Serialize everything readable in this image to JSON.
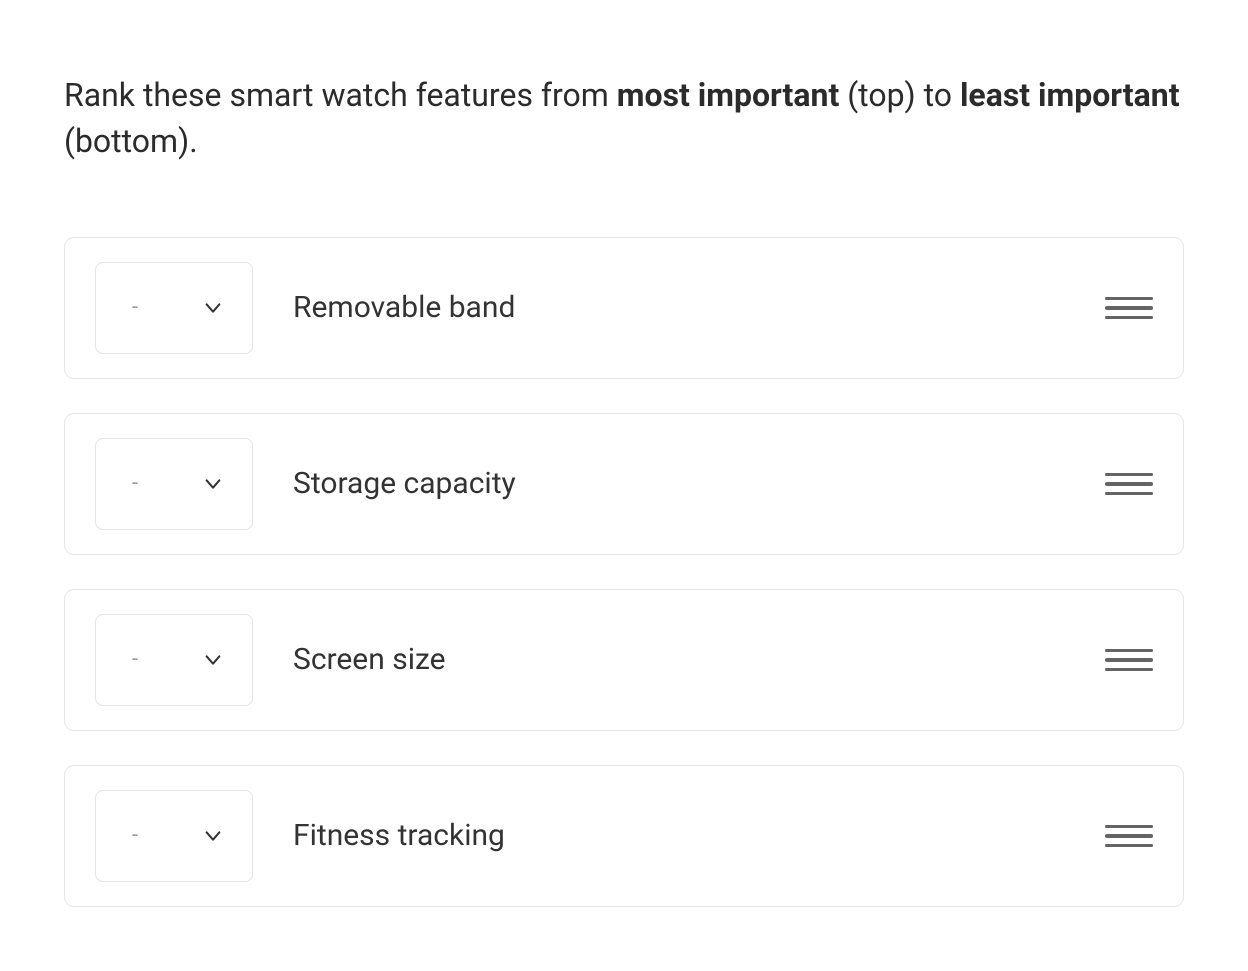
{
  "question": {
    "prefix": "Rank these smart watch features from ",
    "bold1": "most important",
    "middle": " (top) to ",
    "bold2": "least important",
    "suffix": " (bottom)."
  },
  "selectPlaceholder": "-",
  "items": [
    {
      "label": "Removable band"
    },
    {
      "label": "Storage capacity"
    },
    {
      "label": "Screen size"
    },
    {
      "label": "Fitness tracking"
    }
  ]
}
